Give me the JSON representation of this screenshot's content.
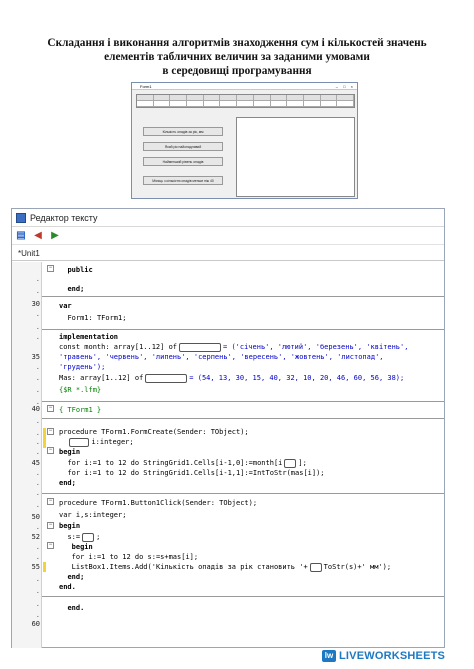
{
  "heading": {
    "line1": "Складання і виконання алгоритмів знаходження сум і кількостей значень",
    "line2": "елементів табличних величин за заданими умовами",
    "line3": "в середовищі програмування"
  },
  "form_preview": {
    "title": "Form1",
    "window_controls": "– □ ×",
    "buttons": [
      "Кількість опадів за рік, мм",
      "Який рік найопадливий",
      "Найменший рівень опадів",
      "Місяць з кількістю опадів менше ніж 40"
    ]
  },
  "editor": {
    "window_title": "Редактор тексту",
    "tab": "*Unit1",
    "gutter": [
      "",
      ".",
      ".",
      "30",
      ".",
      ".",
      ".",
      "35",
      ".",
      ".",
      ".",
      ".",
      "40",
      ".",
      ".",
      ".",
      ".",
      "45",
      ".",
      ".",
      ".",
      ".",
      "50",
      ".",
      "52",
      ".",
      ".",
      "55",
      ".",
      ".",
      ".",
      ".",
      "60"
    ],
    "code": {
      "l1": "public",
      "l3": "end;",
      "l4": "var",
      "l5": "Form1: TForm1;",
      "l7": "implementation",
      "l8a": "const month: array[1..12] of",
      "l8b": "= ('січень', 'лютий', 'березень', 'квітень',",
      "l9": "'травень', 'червень', 'липень', 'серпень', 'вересень', 'жовтень', 'листопад',",
      "l10": "'грудень');",
      "l11a": "Mas: array[1..12] of",
      "l11b": "= (54, 13, 30, 15, 40, 32, 10, 20, 46, 60, 56, 38);",
      "l12": "{$R *.lfm}",
      "l13": "{ TForm1 }",
      "l15": "procedure TForm1.FormCreate(Sender: TObject);",
      "l16b": "i:integer;",
      "l17": "begin",
      "l18a": "for i:=1 to 12 do StringGrid1.Cells[i-1,0]:=month[i",
      "l18b": "];",
      "l19": "for i:=1 to 12 do StringGrid1.Cells[i-1,1]:=IntToStr(mas[i]);",
      "l20": "end;",
      "l22": "procedure TForm1.Button1Click(Sender: TObject);",
      "l23": "var i,s:integer;",
      "l24": "begin",
      "l25a": "s:=",
      "l25b": ";",
      "l26": "begin",
      "l27": "for i:=1 to 12 do s:=s+mas[i];",
      "l28a": "ListBox1.Items.Add('Кількість опадів за рік становить '+",
      "l28b": "ToStr(s)+' мм');",
      "l29": "end;",
      "l30": "end.",
      "l31": "end."
    }
  },
  "watermark": {
    "icon": "lw",
    "text": "LIVEWORKSHEETS"
  }
}
